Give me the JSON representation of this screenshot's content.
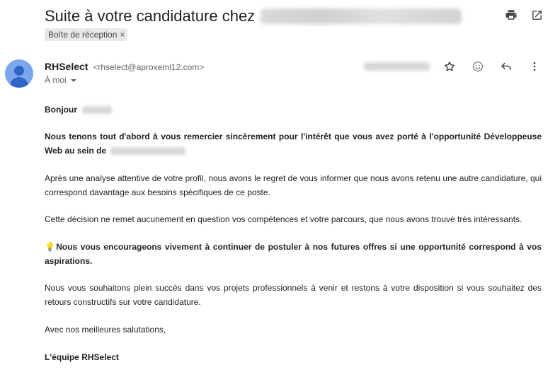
{
  "email": {
    "subject": "Suite à votre candidature chez",
    "label_chip": "Boîte de réception",
    "chip_close": "×",
    "sender_name": "RHSelect",
    "sender_email": "<rhselect@aproxeml12.com>",
    "to_label": "À moi",
    "body": {
      "greeting": "Bonjour",
      "p1": "Nous tenons tout d'abord à vous remercier sincèrement pour l'intérêt que vous avez porté à l'opportunité Développeuse Web au sein de",
      "p2": "Après une analyse attentive de votre profil, nous avons le regret de vous informer que nous avons retenu une autre candidature, qui correspond davantage aux besoins spécifiques de ce poste.",
      "p3": "Cette décision ne remet aucunement en question vos compétences et votre parcours, que nous avons trouvé très intéressants.",
      "p4_emoji": "💡",
      "p4": "Nous vous encourageons vivement à continuer de postuler à nos futures offres si une opportunité correspond à vos aspirations.",
      "p5": "Nous vous souhaitons plein succès dans vos projets professionnels à venir et restons à votre disposition si vous souhaitez des retours constructifs sur votre candidature.",
      "closing": "Avec nos meilleures salutations,",
      "signature": "L'équipe RHSelect"
    }
  },
  "icons": {
    "print": "print-icon",
    "open_new_window": "open-in-new-window-icon",
    "star": "star-icon",
    "emoji": "emoji-icon",
    "reply": "reply-icon",
    "more": "more-vertical-icon"
  },
  "colors": {
    "avatar_bg": "#7aa6ec",
    "avatar_fg": "#2f64c6",
    "chip_bg": "#e8e8e8"
  }
}
